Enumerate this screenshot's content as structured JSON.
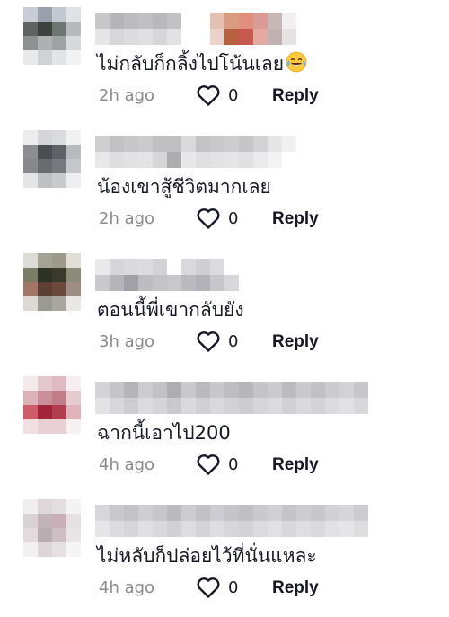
{
  "reply_label": "Reply",
  "comments": [
    {
      "text": "ไม่กลับก็กลิ้งไปโน้นเลย",
      "emoji": "tears-of-joy-emoji",
      "time": "2h ago",
      "likes": "0",
      "username_blurred": true,
      "avatar_colors": [
        "#c9ccd4",
        "#9aa0ab",
        "#c4c8d0",
        "#dfe1e6",
        "#5f6462",
        "#3c423e",
        "#6d7672",
        "#b6babf",
        "#8d9191",
        "#aeb1b2",
        "#9da2a3",
        "#d7d9dc",
        "#e8e9eb",
        "#d0d2d5",
        "#e3e4e6",
        "#f2f2f3"
      ],
      "username_colors": [
        [
          "#c8c8ca",
          "#b5b5b8",
          "#bcbcbf",
          "#c0c0c3",
          "#b8b8bb",
          "#c2c2c5",
          "#ffffff",
          "#ffffff",
          "#e4c1b4",
          "#d89c80",
          "#e08f7e",
          "#d99b93",
          "#c7b8b5",
          "#f1efef"
        ],
        [
          "#e6e6e8",
          "#d7d7da",
          "#dcdcdf",
          "#e0e0e2",
          "#d6d6d9",
          "#e2e2e4",
          "#ffffff",
          "#ffffff",
          "#ead2ca",
          "#b8613f",
          "#c75a4c",
          "#e2aaa3",
          "#bfb2b0",
          "#e5e3e3"
        ]
      ]
    },
    {
      "text": "น้องเขาสู้ชีวิตมากเลย",
      "time": "2h ago",
      "likes": "0",
      "username_blurred": true,
      "avatar_colors": [
        "#ececee",
        "#d5d6d9",
        "#dadbde",
        "#f1f1f2",
        "#8c8d91",
        "#4d4e53",
        "#606166",
        "#b9babd",
        "#87888c",
        "#6a6b70",
        "#77787d",
        "#c6c7ca",
        "#e4e5e7",
        "#bfc0c3",
        "#c9cacd",
        "#eeeef0"
      ],
      "username_colors": [
        [
          "#cfcfd2",
          "#c2c2c5",
          "#c7c7ca",
          "#cbcbce",
          "#c0c0c3",
          "#bfbfc2",
          "#d9d9dc",
          "#c4c4c7",
          "#c9c9cc",
          "#cdcdd0",
          "#c5c5c8",
          "#d2d2d5",
          "#e6e6e8",
          "#f0f0f2",
          "#ffffff"
        ],
        [
          "#e8e8ea",
          "#dedee0",
          "#e2e2e4",
          "#e4e4e6",
          "#d6d6d8",
          "#adadb0",
          "#e8e8ea",
          "#e0e0e2",
          "#e3e3e5",
          "#e6e6e8",
          "#e1e1e3",
          "#eaeaec",
          "#f3f3f4",
          "#ffffff",
          "#ffffff"
        ]
      ]
    },
    {
      "text": "ตอนนี้พี่เขากลับยัง",
      "time": "3h ago",
      "likes": "0",
      "username_blurred": true,
      "avatar_colors": [
        "#dcdcd7",
        "#a3a294",
        "#9d9a8b",
        "#e0ded7",
        "#7b7c64",
        "#2f3326",
        "#3a3a2c",
        "#8d8a78",
        "#a27667",
        "#5d3f33",
        "#6b4a3b",
        "#9d8d83",
        "#ddd9d5",
        "#9a9a93",
        "#a9a6a0",
        "#e9e8e5"
      ],
      "username_colors": [
        [
          "#e9e9ec",
          "#d6d6da",
          "#dadade",
          "#dcdce0",
          "#d2d2d6",
          "#ffffff",
          "#d9d9dd",
          "#cfcfd3",
          "#dbdbdf",
          "#ffffff"
        ],
        [
          "#c8c8cd",
          "#b4b4ba",
          "#a0a0a7",
          "#bcbcc1",
          "#c3c3c8",
          "#c7c7cc",
          "#babac0",
          "#b2b2b8",
          "#c6c6cb",
          "#d8d8dc"
        ]
      ]
    },
    {
      "text": "ฉากนี้เอาไป200",
      "time": "4h ago",
      "likes": "0",
      "username_blurred": true,
      "avatar_colors": [
        "#f3e8ea",
        "#e2c7cc",
        "#dfbcc2",
        "#f6eef0",
        "#dcb2b8",
        "#c98f98",
        "#c07d89",
        "#e5cbd0",
        "#cf5a68",
        "#a2243a",
        "#b23d4f",
        "#e0b3ba",
        "#f1dfe2",
        "#e8d0d4",
        "#eacfd3",
        "#f8f1f2"
      ],
      "username_colors": [
        [
          "#d4d4d8",
          "#c4c4c9",
          "#b4b4ba",
          "#cbcbd0",
          "#c1c1c6",
          "#adadb3",
          "#c8c8cd",
          "#b9b9bf",
          "#c7c7cc",
          "#bdbdc2",
          "#b6b6bc",
          "#c3c3c8",
          "#cacacf",
          "#bbbbc0",
          "#c9c9ce",
          "#c0c0c5",
          "#cbcbd0",
          "#d2d2d6",
          "#c6c6cb"
        ],
        [
          "#e3e3e6",
          "#d8d8dc",
          "#cdcdd2",
          "#dcdce0",
          "#d5d5d9",
          "#c9c9ce",
          "#dadade",
          "#d0d0d4",
          "#d9d9dd",
          "#d2d2d6",
          "#cccdd1",
          "#d6d6da",
          "#dbdbdf",
          "#d1d1d5",
          "#dadade",
          "#d4d4d8",
          "#dcdce0",
          "#e1e1e4",
          "#d8d8dc"
        ]
      ]
    },
    {
      "text": "ไม่หลับก็ปล่อยไว้ที่นั่นแหละ",
      "time": "4h ago",
      "likes": "0",
      "username_blurred": true,
      "avatar_colors": [
        "#f0eeef",
        "#dfd8db",
        "#e3dde0",
        "#f4f2f3",
        "#d9d2d5",
        "#c2b4b9",
        "#c9b0b8",
        "#e6e0e3",
        "#e2dadd",
        "#b9adb1",
        "#cdbfc4",
        "#e9e4e6",
        "#f2f0f1",
        "#dcd6d8",
        "#e5e0e2",
        "#f6f5f5"
      ],
      "username_colors": [
        [
          "#d7d7db",
          "#c8c8cd",
          "#c2c2c7",
          "#cfcfd3",
          "#c6c6cb",
          "#babac0",
          "#cbcbd0",
          "#c0c0c5",
          "#cecbd2",
          "#c4c4c9",
          "#bfbfc4",
          "#c9c9ce",
          "#d0d0d4",
          "#c3c3c8",
          "#cdcdd1",
          "#c7c7cc",
          "#d1d1d5",
          "#d6d6da",
          "#cbcbd0"
        ],
        [
          "#e6e6e9",
          "#dcdce0",
          "#d6d6da",
          "#e0e0e3",
          "#d9d9dd",
          "#d1d1d5",
          "#dddde1",
          "#d4d4d8",
          "#dedee1",
          "#d7d7db",
          "#d3d3d7",
          "#dbdbdf",
          "#e1e1e4",
          "#d8d8dc",
          "#dfdfe2",
          "#dadade",
          "#e2e2e5",
          "#e6e6e9",
          "#dddde0"
        ]
      ]
    }
  ]
}
